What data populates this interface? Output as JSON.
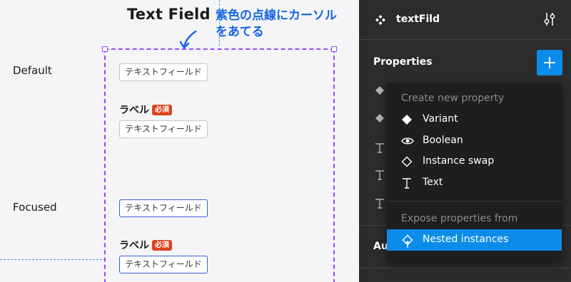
{
  "canvas": {
    "frame_title": "Text Field",
    "annotation_lines": [
      "紫色の点線にカーソル",
      "をあてる"
    ],
    "states": [
      {
        "label": "Default"
      },
      {
        "label": "Focused"
      }
    ],
    "field_placeholder": "テキストフィールド",
    "field_label": "ラベル",
    "required_badge": "必須"
  },
  "panel": {
    "component_name": "textFild",
    "properties_title": "Properties",
    "auto_layout_partial": "Au"
  },
  "menu": {
    "create_heading": "Create new property",
    "items": [
      {
        "label": "Variant",
        "icon": "diamond-filled-icon"
      },
      {
        "label": "Boolean",
        "icon": "eye-icon"
      },
      {
        "label": "Instance swap",
        "icon": "diamond-outline-icon"
      },
      {
        "label": "Text",
        "icon": "text-icon"
      }
    ],
    "expose_heading": "Expose properties from",
    "nested_item": {
      "label": "Nested instances",
      "icon": "nested-instance-icon"
    }
  },
  "colors": {
    "selection": "#9747ff",
    "accent": "#0c8ce9",
    "annotation": "#1665e3",
    "required": "#d9441a"
  }
}
